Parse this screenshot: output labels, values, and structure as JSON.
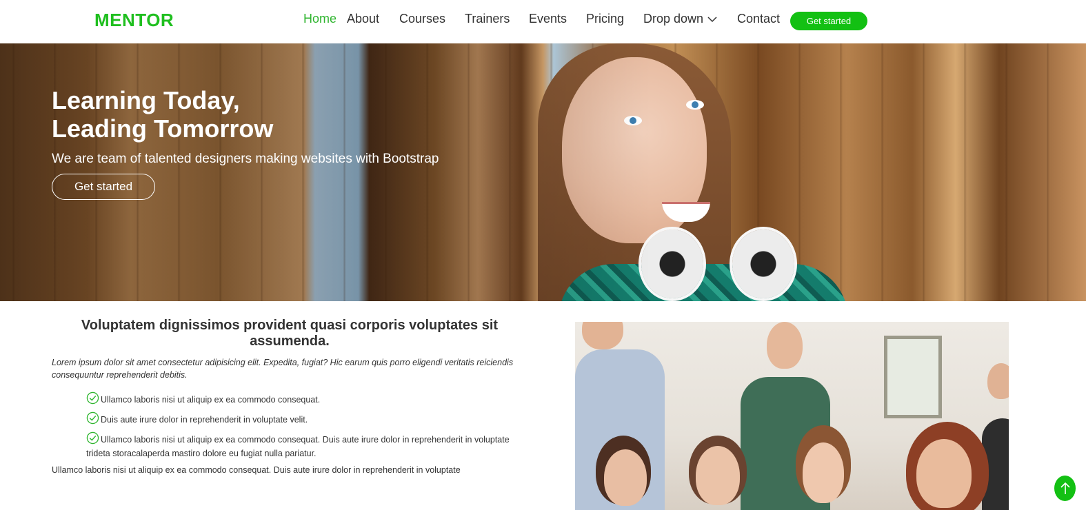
{
  "brand": {
    "logo": "MENTOR",
    "accent": "#13c013"
  },
  "nav": {
    "items": [
      {
        "label": "Home",
        "active": true
      },
      {
        "label": "About"
      },
      {
        "label": "Courses"
      },
      {
        "label": "Trainers"
      },
      {
        "label": "Events"
      },
      {
        "label": "Pricing"
      },
      {
        "label": "Drop down",
        "icon": "chevron-down-icon"
      },
      {
        "label": "Contact"
      }
    ],
    "cta": "Get started"
  },
  "hero": {
    "title_line1": "Learning Today,",
    "title_line2": "Leading Tomorrow",
    "subtitle": "We are team of talented designers making websites with Bootstrap",
    "button": "Get started"
  },
  "about": {
    "title": "Voluptatem dignissimos provident quasi corporis voluptates sit assumenda.",
    "intro": "Lorem ipsum dolor sit amet consectetur adipisicing elit. Expedita, fugiat? Hic earum quis porro eligendi veritatis reiciendis consequuntur reprehenderit debitis.",
    "list": [
      "Ullamco laboris nisi ut aliquip ex ea commodo consequat.",
      "Duis aute irure dolor in reprehenderit in voluptate velit.",
      "Ullamco laboris nisi ut aliquip ex ea commodo consequat. Duis aute irure dolor in reprehenderit in voluptate trideta storacalaperda mastiro dolore eu fugiat nulla pariatur."
    ],
    "outro": "Ullamco laboris nisi ut aliquip ex ea commodo consequat. Duis aute irure dolor in reprehenderit in voluptate"
  },
  "icons": {
    "check": "check-circle-icon",
    "back_to_top": "arrow-up-icon"
  }
}
